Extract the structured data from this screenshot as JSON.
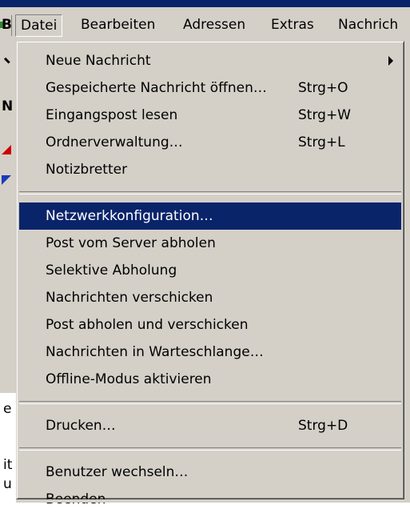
{
  "menubar": {
    "left_glyph": "B",
    "menus": [
      {
        "label": "Datei"
      },
      {
        "label": "Bearbeiten"
      },
      {
        "label": "Adressen"
      },
      {
        "label": "Extras"
      },
      {
        "label": "Nachrich"
      }
    ]
  },
  "background": {
    "letters": [
      "e",
      "it",
      "u"
    ]
  },
  "dropdown": {
    "items": [
      {
        "label": "Neue Nachricht",
        "shortcut": "",
        "submenu": true
      },
      {
        "label": "Gespeicherte Nachricht öffnen…",
        "shortcut": "Strg+O"
      },
      {
        "label": "Eingangspost lesen",
        "shortcut": "Strg+W"
      },
      {
        "label": "Ordnerverwaltung…",
        "shortcut": "Strg+L"
      },
      {
        "label": "Notizbretter",
        "shortcut": ""
      },
      {
        "label": "Netzwerkkonfiguration…",
        "shortcut": "",
        "selected": true
      },
      {
        "label": "Post vom Server abholen",
        "shortcut": ""
      },
      {
        "label": "Selektive Abholung",
        "shortcut": ""
      },
      {
        "label": "Nachrichten verschicken",
        "shortcut": ""
      },
      {
        "label": "Post abholen und verschicken",
        "shortcut": ""
      },
      {
        "label": "Nachrichten in Warteschlange…",
        "shortcut": ""
      },
      {
        "label": "Offline-Modus aktivieren",
        "shortcut": ""
      },
      {
        "label": "Drucken…",
        "shortcut": "Strg+D"
      },
      {
        "label": "Benutzer wechseln…",
        "shortcut": ""
      },
      {
        "label": "Beenden",
        "shortcut": ""
      }
    ]
  },
  "colors": {
    "menu_background": "#d4d0c8",
    "selection_background": "#0a246a",
    "selection_text": "#ffffff"
  }
}
